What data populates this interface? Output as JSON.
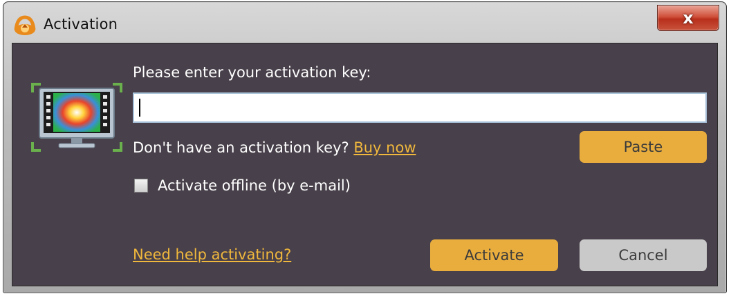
{
  "window": {
    "title": "Activation",
    "close_glyph": "x"
  },
  "icons": {
    "app": "media-player-logo-icon",
    "product": "monitor-filmstrip-icon",
    "close": "close-icon"
  },
  "form": {
    "prompt": "Please enter your activation key:",
    "key_value": "",
    "key_placeholder": "",
    "no_key_text": "Don't have an activation key?",
    "buy_now_link": "Buy now",
    "offline_checkbox_label": "Activate offline (by e-mail)",
    "offline_checked": false,
    "help_link": "Need help activating?"
  },
  "buttons": {
    "paste": "Paste",
    "activate": "Activate",
    "cancel": "Cancel"
  },
  "colors": {
    "client_background": "#48404a",
    "accent_orange": "#e9ad3e",
    "link_orange": "#f0b83c",
    "cancel_grey": "#c9c9c9",
    "close_red": "#c8432e"
  }
}
